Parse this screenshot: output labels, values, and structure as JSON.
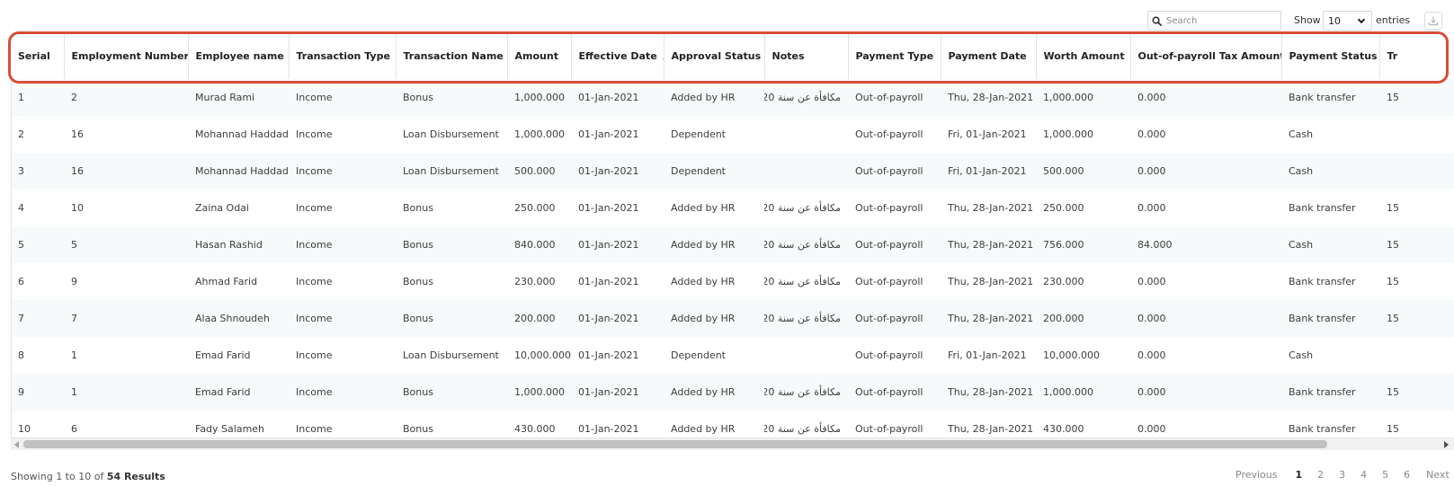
{
  "controls": {
    "search_placeholder": "Search",
    "show_label": "Show",
    "entries_value": "10",
    "entries_label": "entries"
  },
  "table": {
    "columns": [
      "Serial",
      "Employment Number",
      "Employee name",
      "Transaction Type",
      "Transaction Name",
      "Amount",
      "Effective Date",
      "Approval Status",
      "Notes",
      "Payment Type",
      "Payment Date",
      "Worth Amount",
      "Out-of-payroll Tax Amount",
      "Payment Status",
      "Tr"
    ],
    "rows": [
      [
        "1",
        "2",
        "Murad Rami",
        "Income",
        "Bonus",
        "1,000.000",
        "01-Jan-2021",
        "Added by HR",
        "مكافأة عن سنة 2020",
        "Out-of-payroll",
        "Thu, 28-Jan-2021",
        "1,000.000",
        "0.000",
        "Bank transfer",
        "15"
      ],
      [
        "2",
        "16",
        "Mohannad Haddad",
        "Income",
        "Loan Disbursement",
        "1,000.000",
        "01-Jan-2021",
        "Dependent",
        "",
        "Out-of-payroll",
        "Fri, 01-Jan-2021",
        "1,000.000",
        "0.000",
        "Cash",
        ""
      ],
      [
        "3",
        "16",
        "Mohannad Haddad",
        "Income",
        "Loan Disbursement",
        "500.000",
        "01-Jan-2021",
        "Dependent",
        "",
        "Out-of-payroll",
        "Fri, 01-Jan-2021",
        "500.000",
        "0.000",
        "Cash",
        ""
      ],
      [
        "4",
        "10",
        "Zaina Odai",
        "Income",
        "Bonus",
        "250.000",
        "01-Jan-2021",
        "Added by HR",
        "مكافأة عن سنة 2020",
        "Out-of-payroll",
        "Thu, 28-Jan-2021",
        "250.000",
        "0.000",
        "Bank transfer",
        "15"
      ],
      [
        "5",
        "5",
        "Hasan Rashid",
        "Income",
        "Bonus",
        "840.000",
        "01-Jan-2021",
        "Added by HR",
        "مكافأة عن سنة 2020",
        "Out-of-payroll",
        "Thu, 28-Jan-2021",
        "756.000",
        "84.000",
        "Cash",
        "15"
      ],
      [
        "6",
        "9",
        "Ahmad Farid",
        "Income",
        "Bonus",
        "230.000",
        "01-Jan-2021",
        "Added by HR",
        "مكافأة عن سنة 2020",
        "Out-of-payroll",
        "Thu, 28-Jan-2021",
        "230.000",
        "0.000",
        "Bank transfer",
        "15"
      ],
      [
        "7",
        "7",
        "Alaa Shnoudeh",
        "Income",
        "Bonus",
        "200.000",
        "01-Jan-2021",
        "Added by HR",
        "مكافأة عن سنة 2020",
        "Out-of-payroll",
        "Thu, 28-Jan-2021",
        "200.000",
        "0.000",
        "Bank transfer",
        "15"
      ],
      [
        "8",
        "1",
        "Emad Farid",
        "Income",
        "Loan Disbursement",
        "10,000.000",
        "01-Jan-2021",
        "Dependent",
        "",
        "Out-of-payroll",
        "Fri, 01-Jan-2021",
        "10,000.000",
        "0.000",
        "Cash",
        ""
      ],
      [
        "9",
        "1",
        "Emad Farid",
        "Income",
        "Bonus",
        "1,000.000",
        "01-Jan-2021",
        "Added by HR",
        "مكافأة عن سنة 2020",
        "Out-of-payroll",
        "Thu, 28-Jan-2021",
        "1,000.000",
        "0.000",
        "Bank transfer",
        "15"
      ],
      [
        "10",
        "6",
        "Fady Salameh",
        "Income",
        "Bonus",
        "430.000",
        "01-Jan-2021",
        "Added by HR",
        "مكافأة عن سنة 2020",
        "Out-of-payroll",
        "Thu, 28-Jan-2021",
        "430.000",
        "0.000",
        "Bank transfer",
        "15"
      ]
    ]
  },
  "footer": {
    "showing_prefix": "Showing 1 to 10 of",
    "results_count": "54 Results",
    "pagination": {
      "previous": "Previous",
      "pages": [
        "1",
        "2",
        "3",
        "4",
        "5",
        "6"
      ],
      "active_page": "1",
      "next": "Next"
    }
  },
  "colors": {
    "highlight": "#d84d3a",
    "row_stripe": "#f6fafa",
    "scroll_thumb": "#c1c1c1"
  },
  "icons": {
    "search": "search-icon",
    "select_chevron": "chevron-down-icon",
    "export": "download-icon",
    "sort": "sort-icon"
  }
}
